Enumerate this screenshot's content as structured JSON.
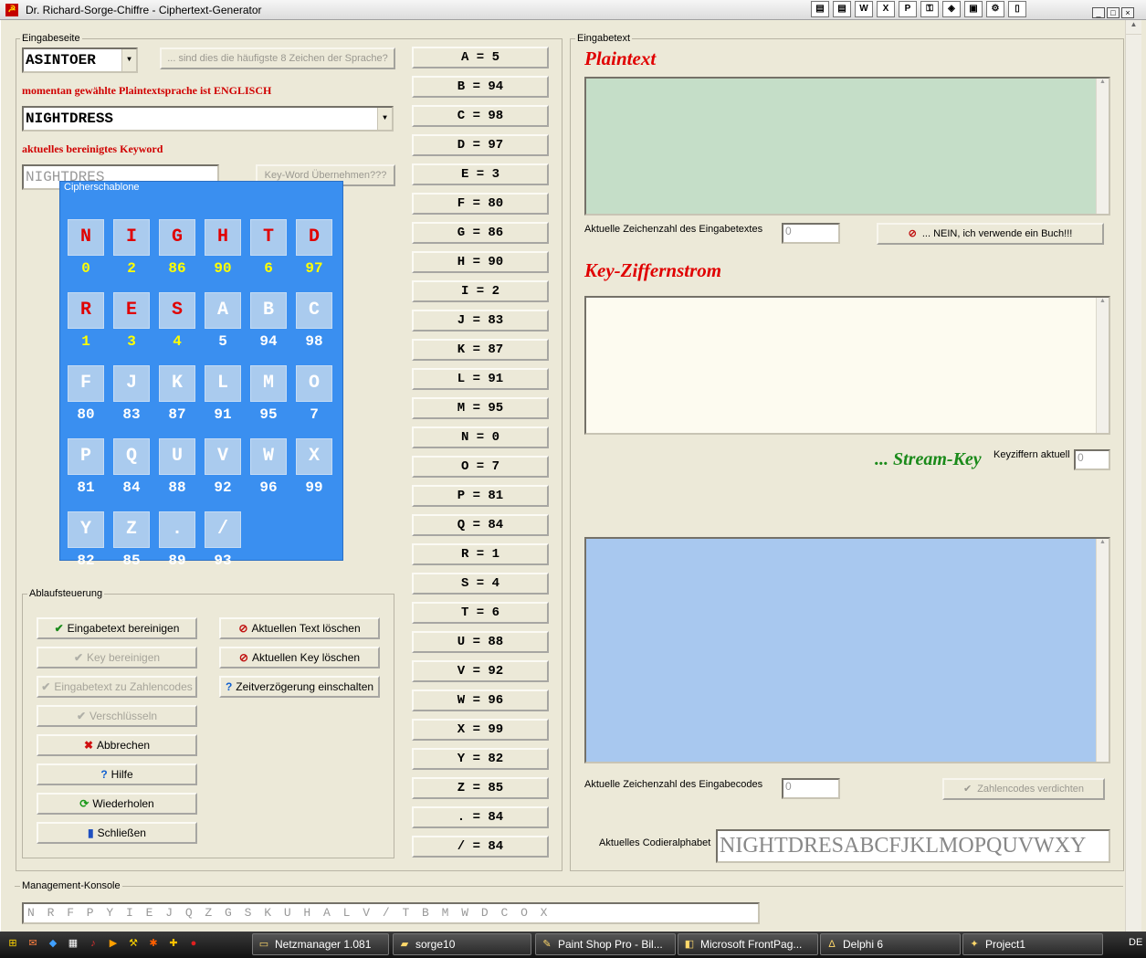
{
  "window": {
    "title": "Dr. Richard-Sorge-Chiffre - Ciphertext-Generator"
  },
  "quicklaunch_icons": [
    "notepad-icon",
    "notepad-icon",
    "word-icon",
    "excel-icon",
    "powerpoint-icon",
    "key-icon",
    "windows-icon",
    "display-icon",
    "gear-icon",
    "document-icon"
  ],
  "left": {
    "group_title": "Eingabeseite",
    "lang_combo_value": "ASINTOER",
    "freq_button": "... sind dies die häufigste 8 Zeichen der Sprache?",
    "lang_info": "momentan gewählte Plaintextsprache ist ENGLISCH",
    "keyword_combo_value": "NIGHTDRESS",
    "keyword_label": "aktuelles bereinigtes Keyword",
    "keyword_clean": "NIGHTDRES",
    "keyword_button": "Key-Word Übernehmen???",
    "cipher_title": "Cipherschablone"
  },
  "cipher_grid": [
    [
      {
        "l": "N",
        "n": "0",
        "hl": true
      },
      {
        "l": "I",
        "n": "2",
        "hl": true
      },
      {
        "l": "G",
        "n": "86",
        "hl": true
      },
      {
        "l": "H",
        "n": "90",
        "hl": true
      },
      {
        "l": "T",
        "n": "6",
        "hl": true
      },
      {
        "l": "D",
        "n": "97",
        "hl": true
      }
    ],
    [
      {
        "l": "R",
        "n": "1",
        "hl": true
      },
      {
        "l": "E",
        "n": "3",
        "hl": true
      },
      {
        "l": "S",
        "n": "4",
        "hl": true
      },
      {
        "l": "A",
        "n": "5",
        "hl": false
      },
      {
        "l": "B",
        "n": "94",
        "hl": false
      },
      {
        "l": "C",
        "n": "98",
        "hl": false
      }
    ],
    [
      {
        "l": "F",
        "n": "80",
        "hl": false
      },
      {
        "l": "J",
        "n": "83",
        "hl": false
      },
      {
        "l": "K",
        "n": "87",
        "hl": false
      },
      {
        "l": "L",
        "n": "91",
        "hl": false
      },
      {
        "l": "M",
        "n": "95",
        "hl": false
      },
      {
        "l": "O",
        "n": "7",
        "hl": false
      }
    ],
    [
      {
        "l": "P",
        "n": "81",
        "hl": false
      },
      {
        "l": "Q",
        "n": "84",
        "hl": false
      },
      {
        "l": "U",
        "n": "88",
        "hl": false
      },
      {
        "l": "V",
        "n": "92",
        "hl": false
      },
      {
        "l": "W",
        "n": "96",
        "hl": false
      },
      {
        "l": "X",
        "n": "99",
        "hl": false
      }
    ],
    [
      {
        "l": "Y",
        "n": "82",
        "hl": false
      },
      {
        "l": "Z",
        "n": "85",
        "hl": false
      },
      {
        "l": ".",
        "n": "89",
        "hl": false
      },
      {
        "l": "/",
        "n": "93",
        "hl": false
      }
    ]
  ],
  "mapping": [
    "A = 5",
    "B = 94",
    "C = 98",
    "D = 97",
    "E = 3",
    "F = 80",
    "G = 86",
    "H = 90",
    "I = 2",
    "J = 83",
    "K = 87",
    "L = 91",
    "M = 95",
    "N = 0",
    "O = 7",
    "P = 81",
    "Q = 84",
    "R = 1",
    "S = 4",
    "T = 6",
    "U = 88",
    "V = 92",
    "W = 96",
    "X = 99",
    "Y = 82",
    "Z = 85",
    ". = 84",
    "/ = 84"
  ],
  "control": {
    "group_title": "Ablaufsteuerung",
    "buttons_left": [
      {
        "label": "Eingabetext bereinigen",
        "icon": "check-icon",
        "glyph": "✔",
        "color": "#1a8a1a",
        "enabled": true
      },
      {
        "label": "Key bereinigen",
        "icon": "check-icon",
        "glyph": "✔",
        "color": "#b0b0a8",
        "enabled": false
      },
      {
        "label": "Eingabetext zu Zahlencodes",
        "icon": "check-icon",
        "glyph": "✔",
        "color": "#b0b0a8",
        "enabled": false
      },
      {
        "label": "Verschlüsseln",
        "icon": "check-icon",
        "glyph": "✔",
        "color": "#b0b0a8",
        "enabled": false
      },
      {
        "label": "Abbrechen",
        "icon": "cancel-x-icon",
        "glyph": "✖",
        "color": "#d01010",
        "enabled": true
      },
      {
        "label": "Hilfe",
        "icon": "help-icon",
        "glyph": "?",
        "color": "#1060d0",
        "enabled": true
      },
      {
        "label": "Wiederholen",
        "icon": "refresh-icon",
        "glyph": "⟳",
        "color": "#1a9a1a",
        "enabled": true
      },
      {
        "label": "Schließen",
        "icon": "exit-door-icon",
        "glyph": "▮",
        "color": "#2050c0",
        "enabled": true
      }
    ],
    "buttons_right": [
      {
        "label": "Aktuellen Text löschen",
        "icon": "no-entry-icon",
        "glyph": "⊘",
        "color": "#c01010",
        "enabled": true
      },
      {
        "label": "Aktuellen Key löschen",
        "icon": "no-entry-icon",
        "glyph": "⊘",
        "color": "#c01010",
        "enabled": true
      },
      {
        "label": "Zeitverzögerung einschalten",
        "icon": "help-icon",
        "glyph": "?",
        "color": "#1060d0",
        "enabled": true
      }
    ]
  },
  "right": {
    "group_title": "Eingabetext",
    "plaintext_heading": "Plaintext",
    "plaintext_count_label": "Aktuelle Zeichenzahl des Eingabetextes",
    "plaintext_count": "0",
    "book_button": "... NEIN, ich verwende ein Buch!!!",
    "key_heading": "Key-Ziffernstrom",
    "stream_key_label": "... Stream-Key",
    "keyziffern_label": "Keyziffern aktuell",
    "keyziffern_value": "0",
    "code_count_label": "Aktuelle Zeichenzahl des Eingabecodes",
    "code_count": "0",
    "compress_button": "Zahlencodes verdichten",
    "alphabet_label": "Aktuelles Codieralphabet",
    "alphabet_value": "NIGHTDRESABCFJKLMOPQUVWXY"
  },
  "console": {
    "title": "Management-Konsole",
    "value": "N R F P Y I E J Q Z G S K U H A L V / T B M W D C O X"
  },
  "taskbar": {
    "tasks": [
      {
        "label": "Netzmanager 1.081",
        "icon": "window-icon"
      },
      {
        "label": "sorge10",
        "icon": "folder-icon"
      },
      {
        "label": "Paint Shop Pro - Bil...",
        "icon": "paint-icon"
      },
      {
        "label": "Microsoft FrontPag...",
        "icon": "frontpage-icon"
      },
      {
        "label": "Delphi 6",
        "icon": "delphi-icon"
      },
      {
        "label": "Project1",
        "icon": "project-icon"
      }
    ],
    "lang": "DE"
  },
  "colors": {
    "plaintext_bg": "#c5dec8",
    "key_bg": "#fdfbf0",
    "cipher_out_bg": "#a8c8ef",
    "cipher_panel": "#3a8ff0",
    "stream_key": "#1a8a1a"
  }
}
